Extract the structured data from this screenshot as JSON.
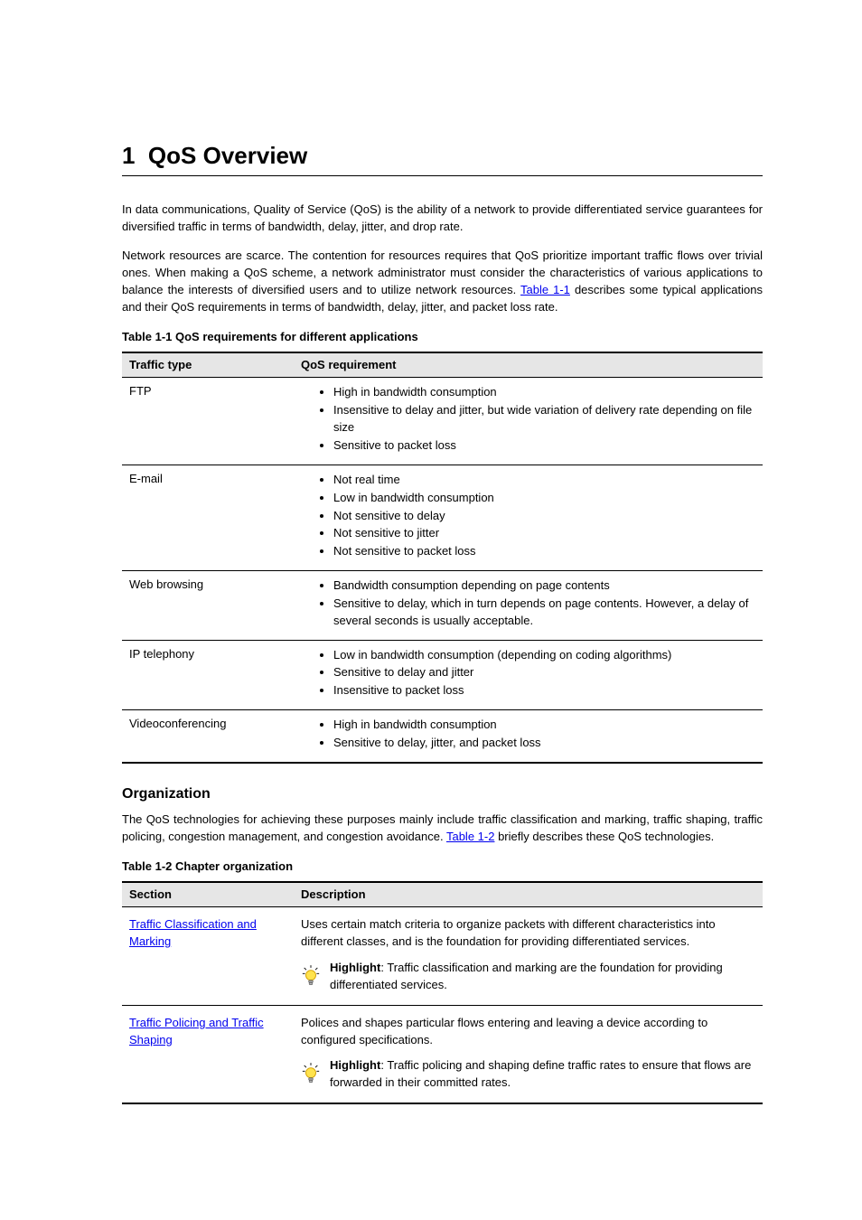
{
  "chapter": {
    "number": "1",
    "title_prefix": "1",
    "title": "QoS Overview",
    "intro_p1": "In data communications, Quality of Service (QoS) is the ability of a network to provide differentiated service guarantees for diversified traffic in terms of bandwidth, delay, jitter, and drop rate.",
    "intro_p2_a": "Network resources are scarce. The contention for resources requires that QoS prioritize important traffic flows over trivial ones. When making a QoS scheme, a network administrator must consider the characteristics of various applications to balance the interests of diversified users and to utilize network resources. ",
    "intro_p2_link": "Table 1-1",
    "intro_p2_b": " describes some typical applications and their QoS requirements in terms of bandwidth, delay, jitter, and packet loss rate."
  },
  "table1": {
    "caption": "Table 1-1 QoS requirements for different applications",
    "headers": [
      "Traffic type",
      "QoS requirement"
    ],
    "rows": [
      {
        "type": "FTP",
        "items": [
          "High in bandwidth consumption",
          "Insensitive to delay and jitter, but wide variation of delivery rate depending on file size",
          "Sensitive to packet loss"
        ]
      },
      {
        "type": "E-mail",
        "items": [
          "Not real time",
          "Low in bandwidth consumption",
          "Not sensitive to delay",
          "Not sensitive to jitter",
          "Not sensitive to packet loss"
        ]
      },
      {
        "type": "Web browsing",
        "items": [
          "Bandwidth consumption depending on page contents",
          "Sensitive to delay, which in turn depends on page contents. However, a delay of several seconds is usually acceptable."
        ]
      },
      {
        "type": "IP telephony",
        "items": [
          "Low in bandwidth consumption (depending on coding algorithms)",
          "Sensitive to delay and jitter",
          "Insensitive to packet loss"
        ]
      },
      {
        "type": "Videoconferencing",
        "items": [
          "High in bandwidth consumption",
          "Sensitive to delay, jitter, and packet loss"
        ]
      }
    ]
  },
  "section": {
    "heading": "Organization",
    "p_a": "The QoS technologies for achieving these purposes mainly include traffic classification and marking, traffic shaping, traffic policing, congestion management, and congestion avoidance. ",
    "p_link": "Table 1-2",
    "p_b": " briefly describes these QoS technologies."
  },
  "table2": {
    "caption": "Table 1-2 Chapter organization",
    "headers": [
      "Section",
      "Description"
    ],
    "highlight_label": "Highlight",
    "rows": [
      {
        "link": "Traffic Classification and Marking",
        "desc": "Uses certain match criteria to organize packets with different characteristics into different classes, and is the foundation for providing differentiated services.",
        "highlight": ": Traffic classification and marking are the foundation for providing differentiated services."
      },
      {
        "link": "Traffic Policing and Traffic Shaping",
        "desc": "Polices and shapes particular flows entering and leaving a device according to configured specifications.",
        "highlight": ": Traffic policing and shaping define traffic rates to ensure that flows are forwarded in their committed rates."
      }
    ]
  }
}
